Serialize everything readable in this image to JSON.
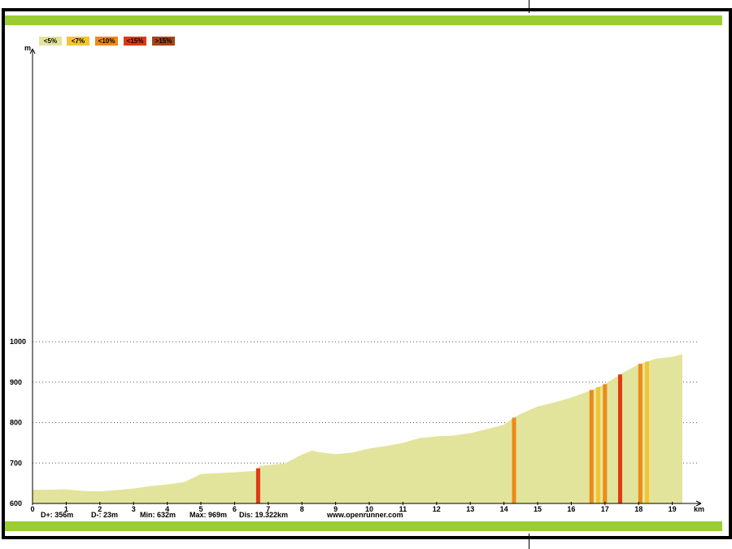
{
  "legend": [
    {
      "label": "<5%",
      "color": "#e3e49c"
    },
    {
      "label": "<7%",
      "color": "#f2c530"
    },
    {
      "label": "<10%",
      "color": "#ec8a18"
    },
    {
      "label": "<15%",
      "color": "#de3a12"
    },
    {
      "label": ">15%",
      "color": "#a34418"
    }
  ],
  "stats": {
    "d_plus": "D+: 356m",
    "d_minus": "D-: 23m",
    "min": "Min: 632m",
    "max": "Max: 969m",
    "dist": "Dis: 19.322km",
    "site": "www.openrunner.com"
  },
  "colors": {
    "frame": "#000000",
    "band": "#9acd32",
    "fill": "#e3e49c",
    "grid": "#555555"
  },
  "chart_data": {
    "type": "area",
    "xlabel": "km",
    "ylabel": "m",
    "xlim": [
      0,
      20
    ],
    "ylim": [
      600,
      1000
    ],
    "x_ticks": [
      0,
      1,
      2,
      3,
      4,
      5,
      6,
      7,
      8,
      9,
      10,
      11,
      12,
      13,
      14,
      15,
      16,
      17,
      18,
      19
    ],
    "y_ticks": [
      600,
      700,
      800,
      900,
      1000
    ],
    "grid": "horizontal dotted",
    "legend_position": "top-left",
    "series": [
      {
        "x": [
          0,
          0.5,
          1,
          1.5,
          2,
          2.5,
          3,
          3.5,
          4,
          4.5,
          5,
          5.5,
          6,
          6.5,
          6.65,
          6.75,
          7,
          7.5,
          8,
          8.3,
          8.5,
          9,
          9.5,
          10,
          10.5,
          11,
          11.5,
          12,
          12.5,
          13,
          13.5,
          14,
          14.25,
          14.5,
          15,
          15.5,
          16,
          16.5,
          17,
          17.5,
          18,
          18.5,
          19,
          19.3
        ],
        "y": [
          634,
          634,
          635,
          631,
          630,
          633,
          637,
          643,
          647,
          653,
          673,
          675,
          677,
          680,
          681,
          693,
          695,
          699,
          721,
          731,
          727,
          722,
          726,
          736,
          742,
          750,
          762,
          766,
          768,
          774,
          784,
          795,
          810,
          822,
          840,
          850,
          862,
          877,
          895,
          922,
          944,
          958,
          963,
          969
        ]
      }
    ],
    "steep_segments": [
      {
        "km": 6.7,
        "grade": "<15%"
      },
      {
        "km": 14.3,
        "grade": "<10%"
      },
      {
        "km": 16.6,
        "grade": "<10%"
      },
      {
        "km": 16.8,
        "grade": "<7%"
      },
      {
        "km": 17.0,
        "grade": "<10%"
      },
      {
        "km": 17.45,
        "grade": "<15%"
      },
      {
        "km": 18.05,
        "grade": "<10%"
      },
      {
        "km": 18.25,
        "grade": "<7%"
      }
    ]
  }
}
